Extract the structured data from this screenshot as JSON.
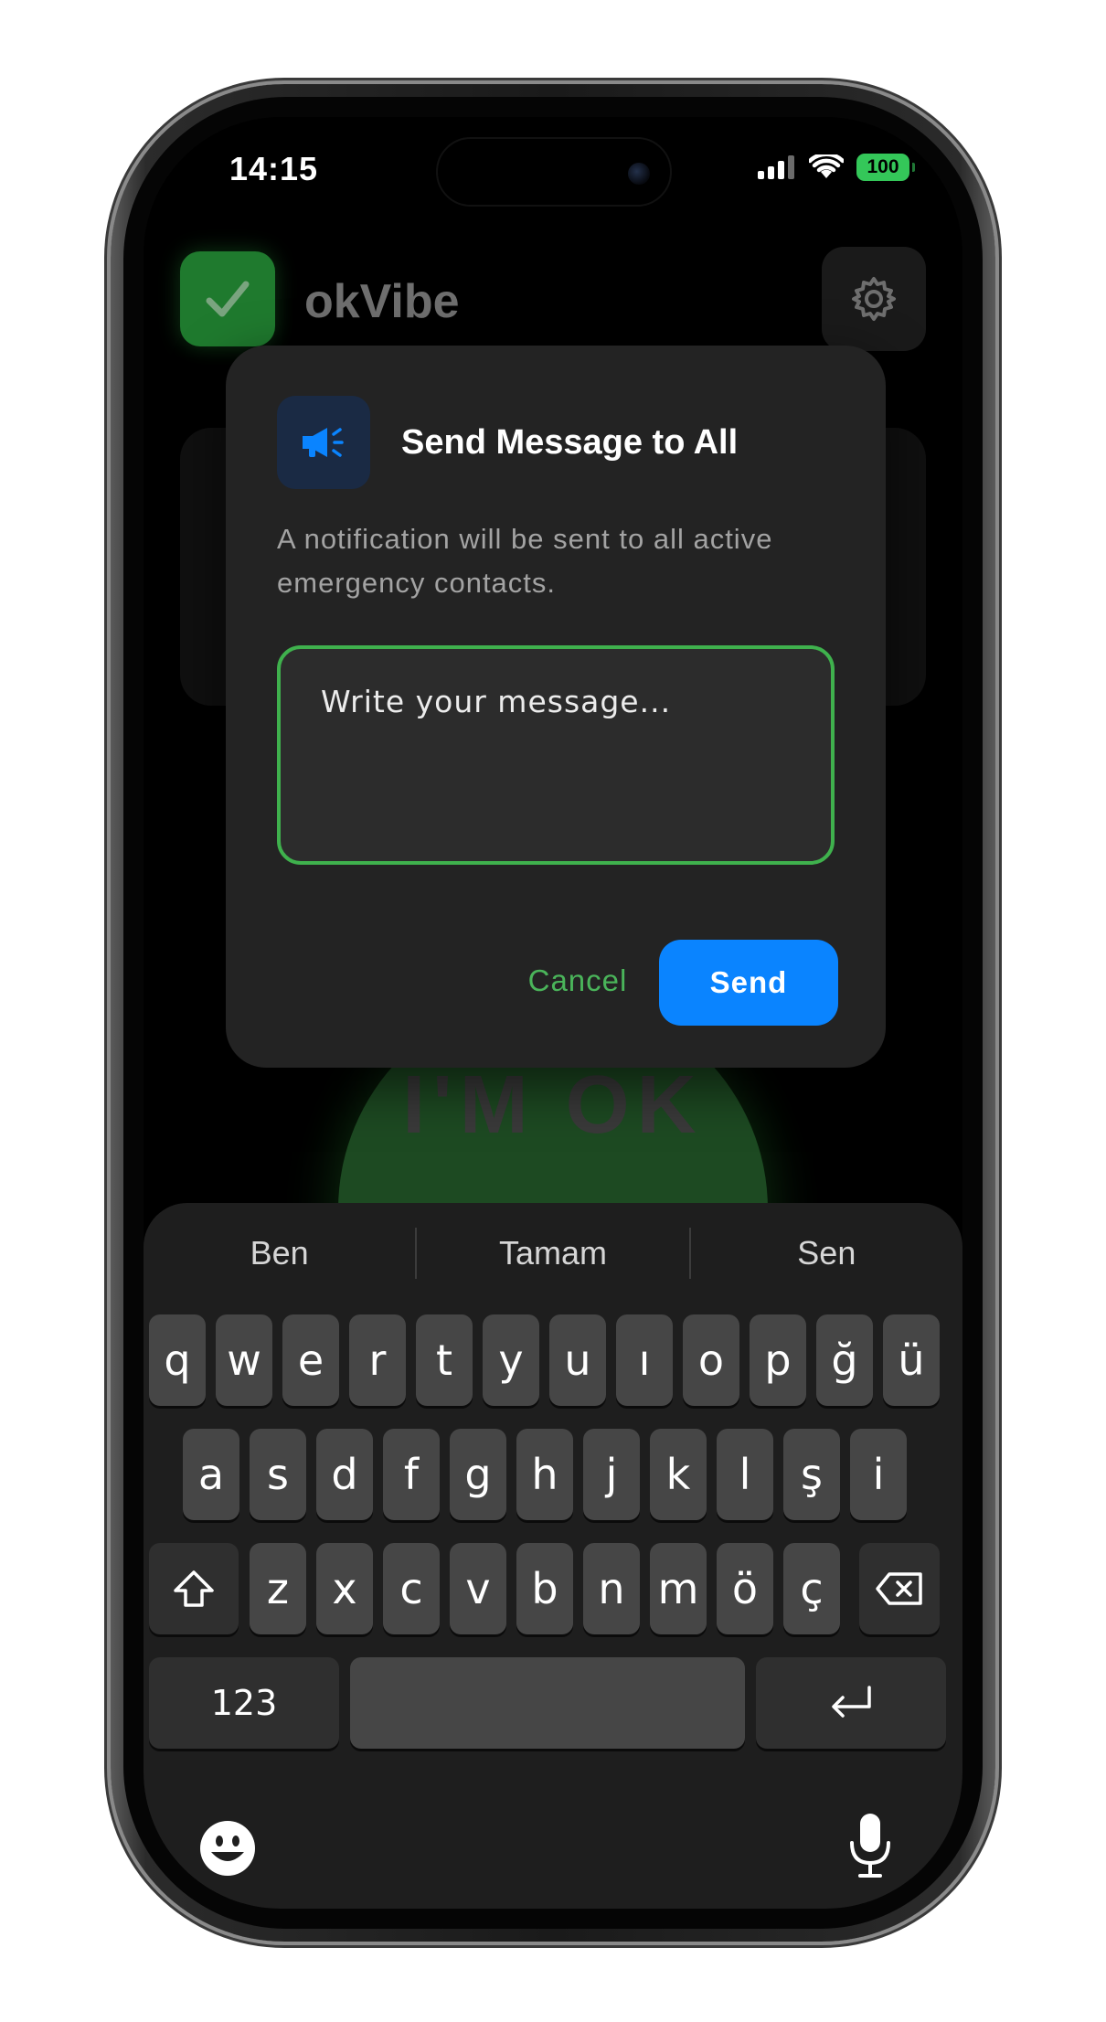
{
  "status_bar": {
    "time": "14:15",
    "battery": "100"
  },
  "app": {
    "title": "okVibe",
    "big_button_label": "I'M OK"
  },
  "dialog": {
    "title": "Send Message to All",
    "description": "A notification will be sent to all active emergency contacts.",
    "input_placeholder": "Write your message...",
    "cancel_label": "Cancel",
    "send_label": "Send"
  },
  "keyboard": {
    "suggestions": [
      "Ben",
      "Tamam",
      "Sen"
    ],
    "row1": [
      "q",
      "w",
      "e",
      "r",
      "t",
      "y",
      "u",
      "ı",
      "o",
      "p",
      "ğ",
      "ü"
    ],
    "row2": [
      "a",
      "s",
      "d",
      "f",
      "g",
      "h",
      "j",
      "k",
      "l",
      "ş",
      "i"
    ],
    "row3": [
      "z",
      "x",
      "c",
      "v",
      "b",
      "n",
      "m",
      "ö",
      "ç"
    ],
    "numbers_label": "123",
    "icons": {
      "shift": "shift-icon",
      "delete": "backspace-icon",
      "return": "return-icon",
      "emoji": "emoji-icon",
      "mic": "microphone-icon"
    }
  },
  "colors": {
    "accent_green": "#3fb14d",
    "send_blue": "#0a84ff",
    "dialog_bg": "#232323",
    "battery_green": "#34c759"
  }
}
